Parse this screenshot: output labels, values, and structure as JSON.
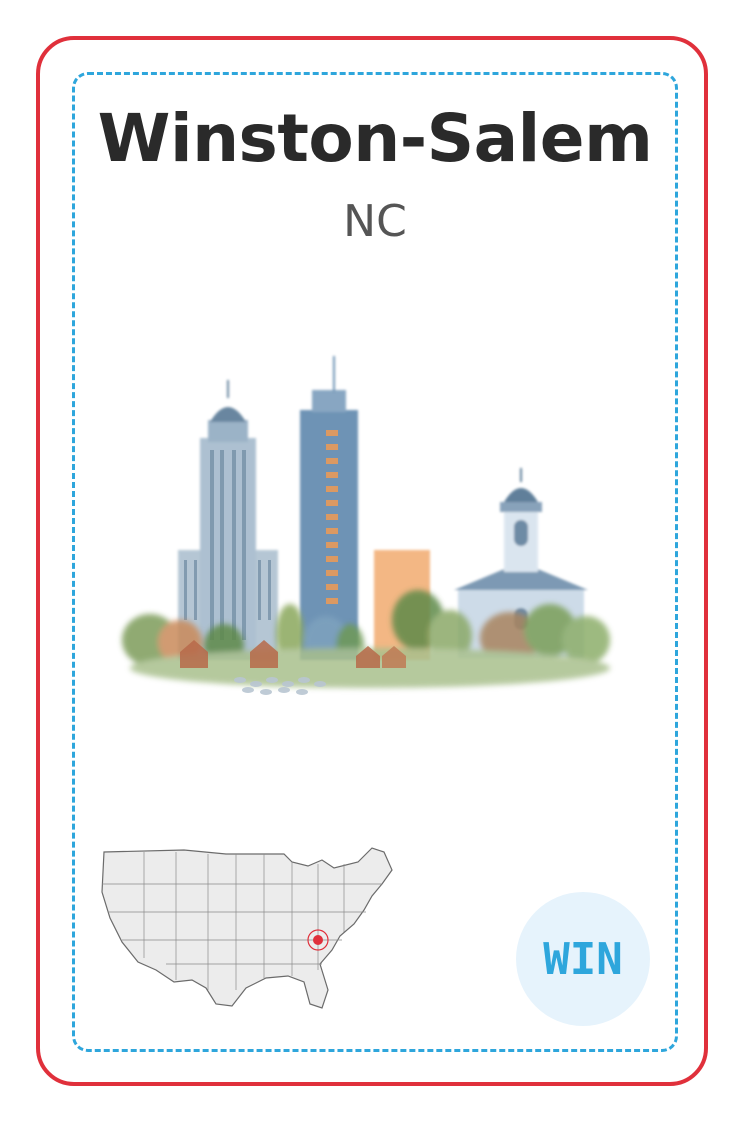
{
  "card": {
    "city": "Winston-Salem",
    "state": "NC",
    "code": "WIN"
  },
  "colors": {
    "card_border": "#e0303b",
    "inner_border": "#2ea6dc",
    "badge_bg": "#e6f3fc",
    "badge_text": "#2ea6dc",
    "map_fill": "#ececec",
    "map_stroke": "#6b6b6b",
    "marker": "#e0303b"
  },
  "illustration": {
    "subject": "watercolor-city-skyline-icon"
  },
  "map": {
    "subject": "us-map-icon",
    "marker": "location-marker-icon"
  }
}
